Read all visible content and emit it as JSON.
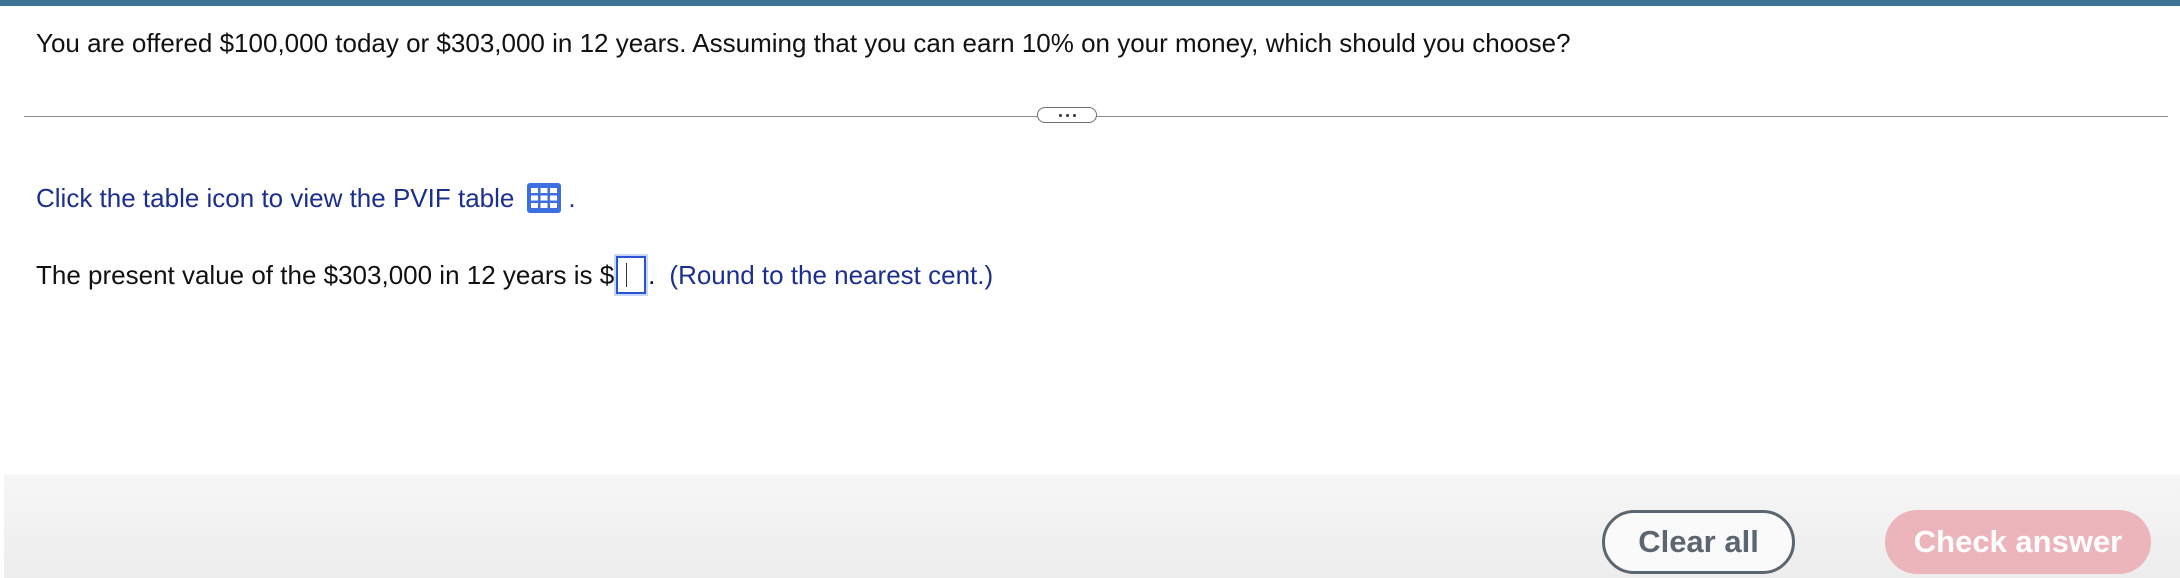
{
  "question": {
    "text": "You are offered $100,000 today or $303,000 in 12 years. Assuming that you can earn 10% on your money, which should you choose?"
  },
  "expand": {
    "icon": "more-dots-icon"
  },
  "table_hint": {
    "text": "Click the table icon to view the PVIF table",
    "period": ".",
    "icon": "table-grid-icon"
  },
  "answer": {
    "prefix": "The present value of the $303,000 in 12 years is $",
    "input_value": "",
    "suffix": ".",
    "note": "(Round to the nearest cent.)"
  },
  "buttons": {
    "clear_label": "Clear all",
    "check_label": "Check answer"
  },
  "colors": {
    "top_bar": "#3a7394",
    "link_text": "#1b2f8f",
    "input_border": "#2a54d6",
    "check_button_disabled": "#ecb5bb",
    "clear_button": "#5c6670",
    "table_icon": "#3d6fe0"
  }
}
